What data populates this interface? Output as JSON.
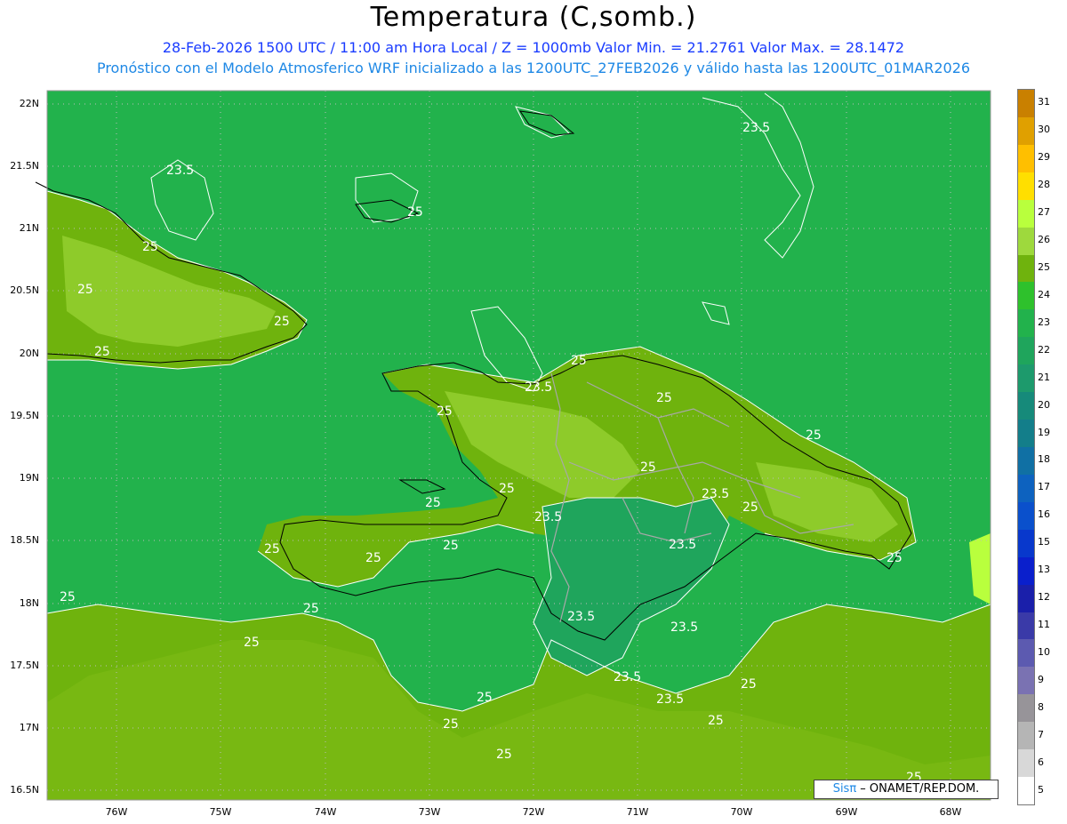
{
  "header": {
    "title": "Temperatura (C,somb.)",
    "subtitle_line1": "28-Feb-2026 1500 UTC / 11:00 am Hora Local / Z = 1000mb   Valor Min. = 21.2761   Valor Max. = 28.1472",
    "subtitle_line2": "Pronóstico con el Modelo Atmosferico WRF inicializado a las 1200UTC_27FEB2026 y válido hasta las  1200UTC_01MAR2026"
  },
  "axes": {
    "lat_labels": [
      "22N",
      "21.5N",
      "21N",
      "20.5N",
      "20N",
      "19.5N",
      "19N",
      "18.5N",
      "18N",
      "17.5N",
      "17N",
      "16.5N"
    ],
    "lon_labels": [
      "76W",
      "75W",
      "74W",
      "73W",
      "72W",
      "71W",
      "70W",
      "69W",
      "68W"
    ]
  },
  "colorbar": {
    "labels": [
      "31",
      "30",
      "29",
      "28",
      "27",
      "26",
      "25",
      "24",
      "23",
      "22",
      "21",
      "20",
      "19",
      "18",
      "17",
      "16",
      "15",
      "13",
      "12",
      "11",
      "10",
      "9",
      "8",
      "7",
      "6",
      "5"
    ],
    "colors": [
      "#c98000",
      "#e0a000",
      "#ffbf00",
      "#ffdf00",
      "#b9ff3d",
      "#9ed93d",
      "#6fb30d",
      "#2ec12c",
      "#22b24c",
      "#1fa55c",
      "#1d9a6c",
      "#168a7a",
      "#137e8a",
      "#1070a4",
      "#0d62bf",
      "#0a50cc",
      "#0838cc",
      "#0a1fcc",
      "#1a1faa",
      "#3a3aa8",
      "#5c5ab0",
      "#7a72b2",
      "#979499",
      "#b5b5b5",
      "#d8d8d8",
      "#ffffff"
    ]
  },
  "contour_labels": [
    "23.5",
    "23.5",
    "25",
    "25",
    "25",
    "25",
    "25",
    "25",
    "25",
    "23.5",
    "25",
    "25",
    "25",
    "25",
    "23.5",
    "25",
    "25",
    "25",
    "25",
    "25",
    "23.5",
    "23.5",
    "25",
    "25",
    "25",
    "23.5",
    "23.5",
    "25",
    "25",
    "25",
    "25",
    "23.5",
    "23.5",
    "25",
    "25",
    "25"
  ],
  "credit": {
    "brand": "Sisπ",
    "text": " –  ONAMET/REP.DOM."
  }
}
